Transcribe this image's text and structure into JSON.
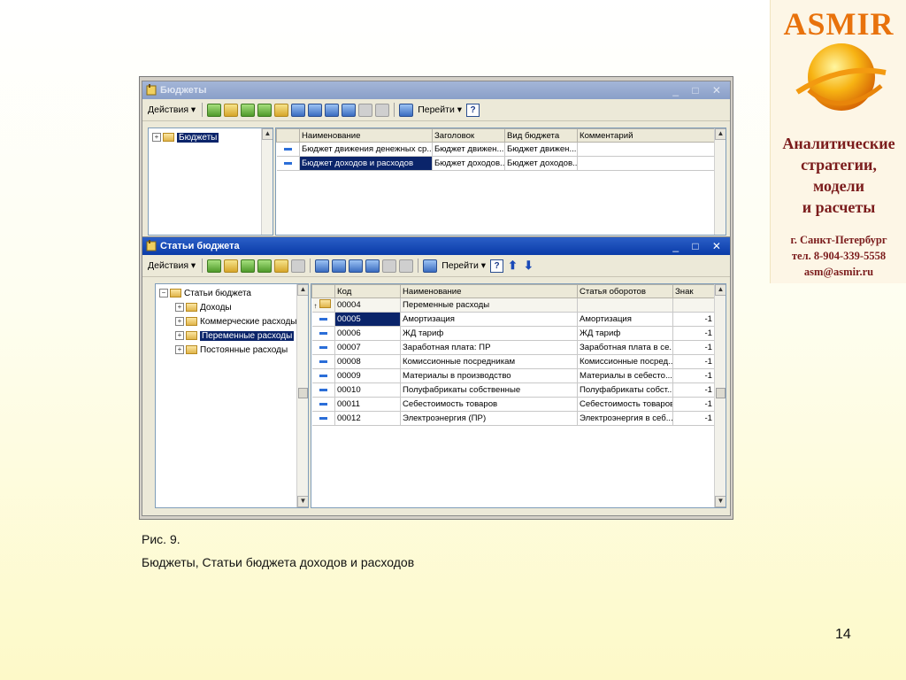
{
  "logo": {
    "brand": "ASMIR",
    "lines": [
      "Аналитические",
      "стратегии,",
      "модели",
      "и расчеты"
    ],
    "city": "г. Санкт-Петербург",
    "phone": "тел. 8-904-339-5558",
    "email": "asm@asmir.ru"
  },
  "budgets_window": {
    "title": "Бюджеты",
    "actions_label": "Действия ▾",
    "goto_label": "Перейти ▾",
    "help": "?",
    "tree_root": "Бюджеты",
    "columns": [
      "Наименование",
      "Заголовок",
      "Вид бюджета",
      "Комментарий"
    ],
    "rows": [
      {
        "name": "Бюджет движения денежных ср...",
        "header": "Бюджет движен...",
        "kind": "Бюджет движен...",
        "comment": ""
      },
      {
        "name": "Бюджет доходов и расходов",
        "header": "Бюджет доходов...",
        "kind": "Бюджет доходов...",
        "comment": ""
      }
    ]
  },
  "items_window": {
    "title": "Статьи бюджета",
    "actions_label": "Действия ▾",
    "goto_label": "Перейти ▾",
    "help": "?",
    "tree": [
      {
        "label": "Статьи бюджета",
        "expander": "⊟"
      },
      {
        "label": "Доходы",
        "expander": "⊞"
      },
      {
        "label": "Коммерческие расходы",
        "expander": "⊞"
      },
      {
        "label": "Переменные расходы",
        "expander": "⊞",
        "selected": true
      },
      {
        "label": "Постоянные расходы",
        "expander": "⊞"
      }
    ],
    "columns": [
      "Код",
      "Наименование",
      "Статья оборотов",
      "Знак"
    ],
    "group_row": {
      "code": "00004",
      "name": "Переменные расходы"
    },
    "rows": [
      {
        "code": "00005",
        "name": "Амортизация",
        "turnover": "Амортизация",
        "sign": "-1"
      },
      {
        "code": "00006",
        "name": "ЖД тариф",
        "turnover": "ЖД тариф",
        "sign": "-1"
      },
      {
        "code": "00007",
        "name": "Заработная плата: ПР",
        "turnover": "Заработная плата в се...",
        "sign": "-1"
      },
      {
        "code": "00008",
        "name": "Комиссионные посредникам",
        "turnover": "Комиссионные посред...",
        "sign": "-1"
      },
      {
        "code": "00009",
        "name": "Материалы в производство",
        "turnover": "Материалы в себесто...",
        "sign": "-1"
      },
      {
        "code": "00010",
        "name": "Полуфабрикаты собственные",
        "turnover": "Полуфабрикаты собст...",
        "sign": "-1"
      },
      {
        "code": "00011",
        "name": "Себестоимость товаров",
        "turnover": "Себестоимость товаров",
        "sign": "-1"
      },
      {
        "code": "00012",
        "name": "Электроэнергия (ПР)",
        "turnover": "Электроэнергия в себ...",
        "sign": "-1"
      }
    ]
  },
  "caption": {
    "line1": "Рис. 9.",
    "line2": "Бюджеты, Статьи бюджета доходов и расходов"
  },
  "page_number": "14"
}
